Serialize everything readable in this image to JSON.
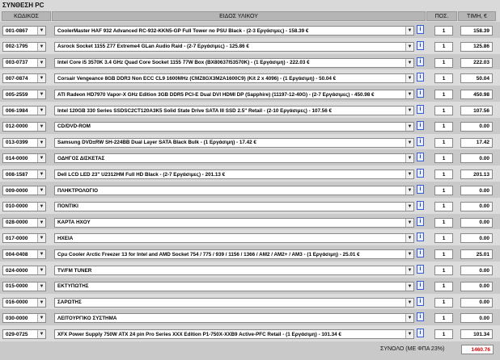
{
  "title": "ΣΥΝΘΕΣΗ PC",
  "headers": {
    "code": "ΚΩΔΙΚΟΣ",
    "item": "ΕΙΔΟΣ ΥΛΙΚΟΥ",
    "qty": "ΠΟΣ.",
    "price": "ΤΙΜΗ, €"
  },
  "info_glyph": "i",
  "rows": [
    {
      "code": "001-0867",
      "desc": "CoolerMaster HAF 932 Advanced RC-932-KKN5-GP Full Tower no PSU Black - (2-3 Εργάσιμες) - 158.39 €",
      "qty": "1",
      "price": "158.39"
    },
    {
      "code": "002-1795",
      "desc": "Asrock Socket 1155 Z77 Extreme4 GLan Audio Raid - (2-7 Εργάσιμες) - 125.86 €",
      "qty": "1",
      "price": "125.86"
    },
    {
      "code": "003-0737",
      "desc": "Intel Core i5 3570K 3.4 GHz Quad Core Socket 1155 77W Box (BX80637I53570K) - (1 Εργάσιμη) - 222.03 €",
      "qty": "1",
      "price": "222.03"
    },
    {
      "code": "007-0874",
      "desc": "Corsair Vengeance 8GB DDR3 Non ECC CL9 1600MHz (CMZ8GX3M2A1600C9) (Kit 2 x 4096) - (1 Εργάσιμη) - 50.04 €",
      "qty": "1",
      "price": "50.04"
    },
    {
      "code": "005-2559",
      "desc": "ATI Radeon HD7970 Vapor-X GHz Edition 3GB DDR5 PCI-E Dual DVI HDMI DP (Sapphire) (11197-12-40G) - (2-7 Εργάσιμες) - 450.98 €",
      "qty": "1",
      "price": "450.98"
    },
    {
      "code": "006-1984",
      "desc": "Intel 120GB 330 Series SSDSC2CT120A3K5 Solid State Drive SATA III SSD 2.5\" Retail - (2-10 Εργάσιμες) - 107.56 €",
      "qty": "1",
      "price": "107.56"
    },
    {
      "code": "012-0000",
      "desc": "CD/DVD-ROM",
      "qty": "1",
      "price": "0.00"
    },
    {
      "code": "013-0399",
      "desc": "Samsung DVD±RW SH-224BB Dual Layer SATA Black Bulk - (1 Εργάσιμη) - 17.42 €",
      "qty": "1",
      "price": "17.42"
    },
    {
      "code": "014-0000",
      "desc": "ΟΔΗΓΟΣ ΔΙΣΚΕΤΑΣ",
      "qty": "1",
      "price": "0.00"
    },
    {
      "code": "008-1587",
      "desc": "Dell LCD LED 23\" U2312HM Full HD Black - (2-7 Εργάσιμες) - 201.13 €",
      "qty": "1",
      "price": "201.13"
    },
    {
      "code": "009-0000",
      "desc": "ΠΛΗΚΤΡΟΛΟΓΙΟ",
      "qty": "1",
      "price": "0.00"
    },
    {
      "code": "010-0000",
      "desc": "ΠΟΝΤΙΚΙ",
      "qty": "1",
      "price": "0.00"
    },
    {
      "code": "028-0000",
      "desc": "ΚΑΡΤΑ ΗΧΟΥ",
      "qty": "1",
      "price": "0.00"
    },
    {
      "code": "017-0000",
      "desc": "ΗΧΕΙΑ",
      "qty": "1",
      "price": "0.00"
    },
    {
      "code": "004-0408",
      "desc": "Cpu Cooler Arctic Freezer 13 for Intel and AMD Socket 754 / 775 / 939 / 1156 / 1366 / AM2 / AM2+ / AM3 - (1 Εργάσιμη) - 25.01 €",
      "qty": "1",
      "price": "25.01"
    },
    {
      "code": "024-0000",
      "desc": "TV/FM TUNER",
      "qty": "1",
      "price": "0.00"
    },
    {
      "code": "015-0000",
      "desc": "ΕΚΤΥΠΩΤΗΣ",
      "qty": "1",
      "price": "0.00"
    },
    {
      "code": "016-0000",
      "desc": "ΣΑΡΩΤΗΣ",
      "qty": "1",
      "price": "0.00"
    },
    {
      "code": "030-0000",
      "desc": "ΛΕΙΤΟΥΡΓΙΚΟ ΣΥΣΤΗΜΑ",
      "qty": "1",
      "price": "0.00"
    },
    {
      "code": "029-0725",
      "desc": "XFX Power Supply 750W ATX 24 pin Pro Series XXX Edition P1-750X-XXB9 Active-PFC Retail - (1 Εργάσιμη) - 101.34 €",
      "qty": "1",
      "price": "101.34"
    }
  ],
  "total": {
    "label": "ΣΥΝΟΛΟ (ΜΕ ΦΠΑ 23%)",
    "value": "1460.76"
  }
}
